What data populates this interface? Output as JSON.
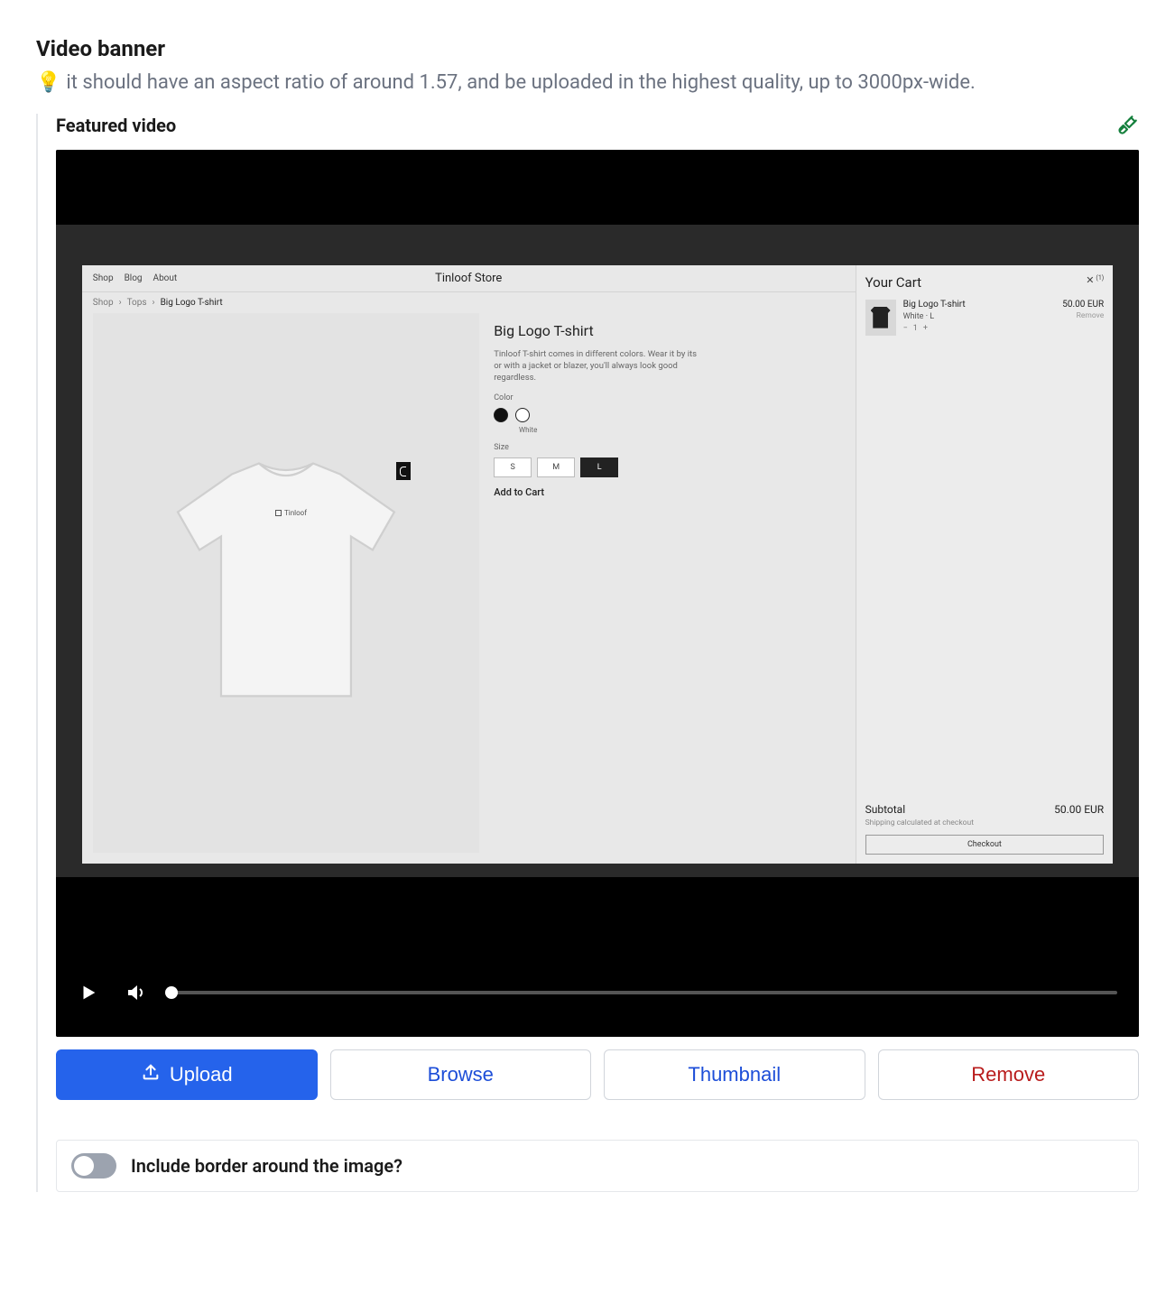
{
  "section": {
    "title": "Video banner",
    "hint_icon": "💡",
    "hint": "it should have an aspect ratio of around 1.57, and be uploaded in the highest quality, up to 3000px-wide."
  },
  "block": {
    "title": "Featured video"
  },
  "actions": {
    "upload": "Upload",
    "browse": "Browse",
    "thumbnail": "Thumbnail",
    "remove": "Remove"
  },
  "toggle": {
    "label": "Include border around the image?"
  },
  "video_store": {
    "nav": [
      "Shop",
      "Blog",
      "About"
    ],
    "brand": "Tinloof Store",
    "breadcrumbs": [
      "Shop",
      "Tops",
      "Big Logo T-shirt"
    ],
    "product": {
      "title": "Big Logo T-shirt",
      "description": "Tinloof T-shirt comes in different colors. Wear it by its or with a jacket or blazer, you'll always look good regardless.",
      "color_label": "Color",
      "color_selected_caption": "White",
      "size_label": "Size",
      "sizes": [
        "S",
        "M",
        "L"
      ],
      "size_selected": "L",
      "add_to_cart": "Add to Cart",
      "image_logo": "Tinloof"
    },
    "cart": {
      "title": "Your Cart",
      "close_count": "(1)",
      "item": {
        "name": "Big Logo T-shirt",
        "variant": "White · L",
        "qty": "1",
        "price": "50.00 EUR",
        "remove": "Remove"
      },
      "subtotal_label": "Subtotal",
      "subtotal_value": "50.00 EUR",
      "shipping_note": "Shipping calculated at checkout",
      "checkout": "Checkout"
    }
  }
}
